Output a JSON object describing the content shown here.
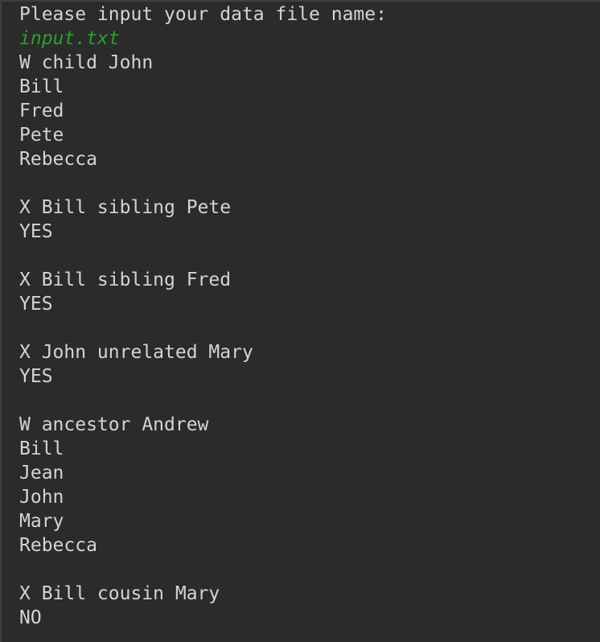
{
  "console": {
    "prompt": "Please input your data file name:",
    "user_input": "input.txt",
    "lines": [
      "W child John",
      "Bill",
      "Fred",
      "Pete",
      "Rebecca",
      "",
      "X Bill sibling Pete",
      "YES",
      "",
      "X Bill sibling Fred",
      "YES",
      "",
      "X John unrelated Mary",
      "YES",
      "",
      "W ancestor Andrew",
      "Bill",
      "Jean",
      "John",
      "Mary",
      "Rebecca",
      "",
      "X Bill cousin Mary",
      "NO"
    ]
  },
  "colors": {
    "background": "#2b2b2b",
    "text": "#d4d4d4",
    "user_input": "#2e9e2e"
  }
}
